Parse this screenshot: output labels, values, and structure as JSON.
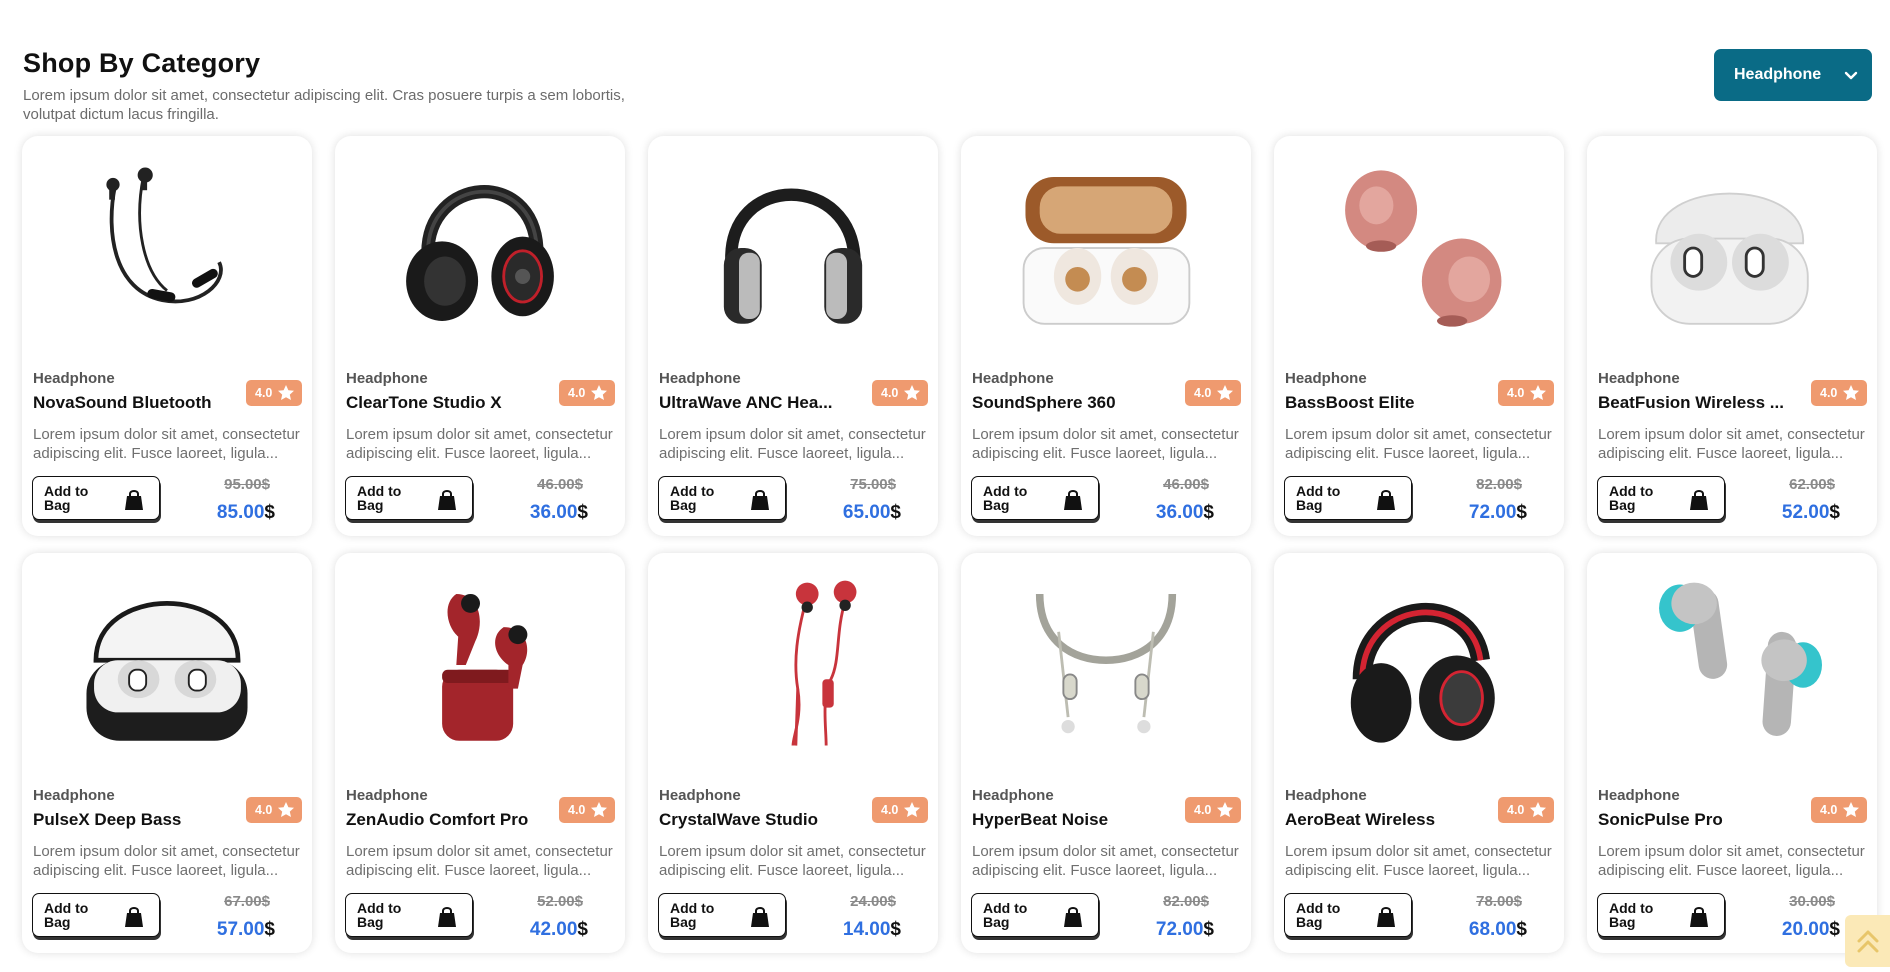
{
  "section": {
    "title": "Shop By Category",
    "subtitle": "Lorem ipsum dolor sit amet, consectetur adipiscing elit. Cras posuere turpis a sem lobortis, volutpat dictum lacus fringilla."
  },
  "filter": {
    "selected": "Headphone"
  },
  "labels": {
    "add_to_bag": "Add to Bag",
    "currency": "$"
  },
  "colors": {
    "brand": "#0a6b86",
    "rating_badge": "#ef9a6f",
    "price": "#2f6fe0",
    "scroll_top": "#fbe9b7"
  },
  "products": [
    {
      "category": "Headphone",
      "name": "NovaSound Bluetooth",
      "rating": "4.0",
      "description": "Lorem ipsum dolor sit amet, consectetur adipiscing elit. Fusce laoreet, ligula...",
      "old_price": "95.00$",
      "price": "85.00",
      "image": "neckband-black"
    },
    {
      "category": "Headphone",
      "name": "ClearTone Studio X",
      "rating": "4.0",
      "description": "Lorem ipsum dolor sit amet, consectetur adipiscing elit. Fusce laoreet, ligula...",
      "old_price": "46.00$",
      "price": "36.00",
      "image": "over-ear-black-red"
    },
    {
      "category": "Headphone",
      "name": "UltraWave ANC Hea...",
      "rating": "4.0",
      "description": "Lorem ipsum dolor sit amet, consectetur adipiscing elit. Fusce laoreet, ligula...",
      "old_price": "75.00$",
      "price": "65.00",
      "image": "over-ear-silver"
    },
    {
      "category": "Headphone",
      "name": "SoundSphere 360",
      "rating": "4.0",
      "description": "Lorem ipsum dolor sit amet, consectetur adipiscing elit. Fusce laoreet, ligula...",
      "old_price": "46.00$",
      "price": "36.00",
      "image": "earbuds-case-bronze"
    },
    {
      "category": "Headphone",
      "name": "BassBoost Elite",
      "rating": "4.0",
      "description": "Lorem ipsum dolor sit amet, consectetur adipiscing elit. Fusce laoreet, ligula...",
      "old_price": "82.00$",
      "price": "72.00",
      "image": "earbuds-pink"
    },
    {
      "category": "Headphone",
      "name": "BeatFusion Wireless ...",
      "rating": "4.0",
      "description": "Lorem ipsum dolor sit amet, consectetur adipiscing elit. Fusce laoreet, ligula...",
      "old_price": "62.00$",
      "price": "52.00",
      "image": "earbuds-case-white"
    },
    {
      "category": "Headphone",
      "name": "PulseX Deep Bass",
      "rating": "4.0",
      "description": "Lorem ipsum dolor sit amet, consectetur adipiscing elit. Fusce laoreet, ligula...",
      "old_price": "67.00$",
      "price": "57.00",
      "image": "earbuds-case-black"
    },
    {
      "category": "Headphone",
      "name": "ZenAudio Comfort Pro",
      "rating": "4.0",
      "description": "Lorem ipsum dolor sit amet, consectetur adipiscing elit. Fusce laoreet, ligula...",
      "old_price": "52.00$",
      "price": "42.00",
      "image": "earbuds-red"
    },
    {
      "category": "Headphone",
      "name": "CrystalWave Studio",
      "rating": "4.0",
      "description": "Lorem ipsum dolor sit amet, consectetur adipiscing elit. Fusce laoreet, ligula...",
      "old_price": "24.00$",
      "price": "14.00",
      "image": "wired-red"
    },
    {
      "category": "Headphone",
      "name": "HyperBeat Noise",
      "rating": "4.0",
      "description": "Lorem ipsum dolor sit amet, consectetur adipiscing elit. Fusce laoreet, ligula...",
      "old_price": "82.00$",
      "price": "72.00",
      "image": "neckband-grey"
    },
    {
      "category": "Headphone",
      "name": "AeroBeat Wireless",
      "rating": "4.0",
      "description": "Lorem ipsum dolor sit amet, consectetur adipiscing elit. Fusce laoreet, ligula...",
      "old_price": "78.00$",
      "price": "68.00",
      "image": "over-ear-red-black"
    },
    {
      "category": "Headphone",
      "name": "SonicPulse Pro",
      "rating": "4.0",
      "description": "Lorem ipsum dolor sit amet, consectetur adipiscing elit. Fusce laoreet, ligula...",
      "old_price": "30.00$",
      "price": "20.00",
      "image": "earbuds-grey-teal"
    }
  ]
}
